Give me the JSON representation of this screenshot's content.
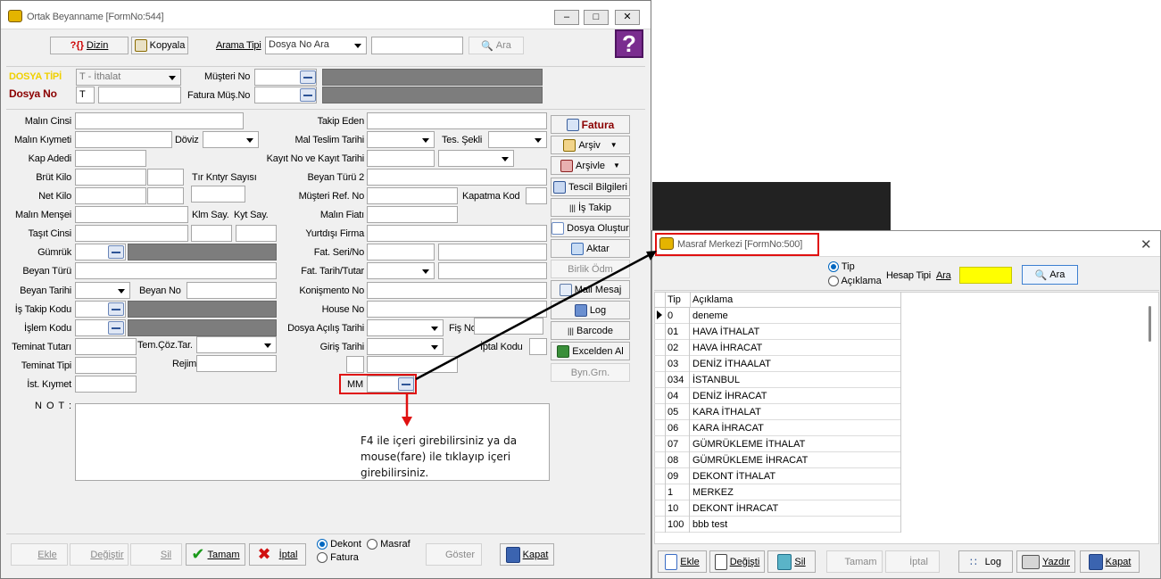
{
  "main_window": {
    "title": "Ortak Beyanname [FormNo:544]",
    "toolbar": {
      "dizin_label": "Dizin",
      "kopyala_label": "Kopyala",
      "arama_tipi_label": "Arama Tipi",
      "arama_tipi_value": "Dosya No Ara",
      "ara_label": "Ara"
    },
    "header": {
      "dosya_tipi_label": "DOSYA TİPİ",
      "dosya_tipi_value": "T - İthalat",
      "dosya_no_label": "Dosya No",
      "dosya_no_value": "T",
      "musteri_no_label": "Müşteri No",
      "fatura_mus_no_label": "Fatura Müş.No"
    },
    "form_left": {
      "malin_cinsi": "Malın Cinsi",
      "malin_kiymeti": "Malın Kıymeti",
      "doviz": "Döviz",
      "kap_adedi": "Kap Adedi",
      "brut_kilo": "Brüt Kilo",
      "tir_kntyr_sayisi": "Tır Kntyr Sayısı",
      "net_kilo": "Net Kilo",
      "malin_mensei": "Malın Menşei",
      "klm_say": "Klm Say.",
      "kyt_say": "Kyt Say.",
      "tasit_cinsi": "Taşıt Cinsi",
      "gumruk": "Gümrük",
      "beyan_turu": "Beyan Türü",
      "beyan_tarihi": "Beyan Tarihi",
      "beyan_no": "Beyan No",
      "is_takip_kodu": "İş Takip Kodu",
      "islem_kodu": "İşlem Kodu",
      "teminat_tutari": "Teminat Tutarı",
      "tem_coz_tar": "Tem.Çöz.Tar.",
      "teminat_tipi": "Teminat Tipi",
      "rejim": "Rejim",
      "ist_kiymet": "İst. Kıymet",
      "not": "N O T :"
    },
    "form_right": {
      "takip_eden": "Takip Eden",
      "mal_teslim_tarihi": "Mal Teslim Tarihi",
      "tes_sekli": "Tes. Şekli",
      "kayit_no_tarihi": "Kayıt  No  ve Kayıt Tarihi",
      "beyan_turu_2": "Beyan Türü 2",
      "musteri_ref_no": "Müşteri  Ref. No",
      "kapatma_kod": "Kapatma Kod",
      "malin_fiati": "Malın Fiatı",
      "yurtdisi_firma": "Yurtdışı Firma",
      "fat_seri_no": "Fat. Seri/No",
      "fat_tarih_tutar": "Fat. Tarih/Tutar",
      "konismento_no": "Konişmento No",
      "house_no": "House No",
      "dosya_acilis_tarihi": "Dosya Açılış Tarihi",
      "fis_no": "Fiş No",
      "giris_tarihi": "Giriş Tarihi",
      "iptal_kodu": "İptal Kodu",
      "mm_label": "MM"
    },
    "side_buttons": {
      "fatura": "Fatura",
      "arsiv": "Arşiv",
      "arsivle": "Arşivle",
      "tescil_bilgileri": "Tescil Bilgileri",
      "is_takip": "İş Takip",
      "dosya_olustur": "Dosya Oluştur",
      "aktar": "Aktar",
      "birlik_odm": "Birlik Ödm",
      "mail_mesaj": "Mail Mesaj",
      "log": "Log",
      "barcode": "Barcode",
      "excelden_al": "Excelden Al",
      "byn_grn": "Byn.Grn."
    },
    "annotation": "F4 ile içeri girebilirsiniz ya da mouse(fare) ile tıklayıp içeri girebilirsiniz.",
    "bottom": {
      "ekle": "Ekle",
      "degistir": "Değiştir",
      "sil": "Sil",
      "tamam": "Tamam",
      "iptal": "İptal",
      "dekont": "Dekont",
      "masraf": "Masraf",
      "fatura": "Fatura",
      "goster": "Göster",
      "kapat": "Kapat"
    }
  },
  "popup": {
    "title": "Masraf Merkezi [FormNo:500]",
    "radio_tip": "Tip",
    "radio_aciklama": "Açıklama",
    "hesap_tipi_label": "Hesap Tipi",
    "ara_label": "Ara",
    "ara_button": "Ara",
    "columns": {
      "tip": "Tip",
      "aciklama": "Açıklama"
    },
    "rows": [
      {
        "tip": "0",
        "aciklama": "deneme"
      },
      {
        "tip": "01",
        "aciklama": "HAVA İTHALAT"
      },
      {
        "tip": "02",
        "aciklama": "HAVA İHRACAT"
      },
      {
        "tip": "03",
        "aciklama": "DENİZ İTHAALAT"
      },
      {
        "tip": "034",
        "aciklama": "İSTANBUL"
      },
      {
        "tip": "04",
        "aciklama": "DENİZ İHRACAT"
      },
      {
        "tip": "05",
        "aciklama": "KARA İTHALAT"
      },
      {
        "tip": "06",
        "aciklama": "KARA İHRACAT"
      },
      {
        "tip": "07",
        "aciklama": "GÜMRÜKLEME İTHALAT"
      },
      {
        "tip": "08",
        "aciklama": "GÜMRÜKLEME İHRACAT"
      },
      {
        "tip": "09",
        "aciklama": "DEKONT İTHALAT"
      },
      {
        "tip": "1",
        "aciklama": "MERKEZ"
      },
      {
        "tip": "10",
        "aciklama": "DEKONT İHRACAT"
      },
      {
        "tip": "100",
        "aciklama": "bbb test"
      }
    ],
    "bottom": {
      "ekle": "Ekle",
      "degistir": "Değişti",
      "sil": "Sil",
      "tamam": "Tamam",
      "iptal": "İptal",
      "log": "Log",
      "yazdir": "Yazdır",
      "kapat": "Kapat"
    }
  },
  "colors": {
    "highlight_red": "#e01010",
    "popup_search_yellow": "#ffff00",
    "title_bar": "#ffffff"
  }
}
